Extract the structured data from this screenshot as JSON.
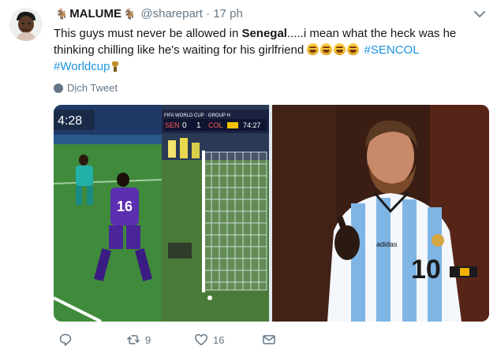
{
  "tweet": {
    "author_name": "MALUME",
    "handle": "@sharepart",
    "separator": "·",
    "time": "17 ph",
    "text_parts": {
      "t1": "This guys must never be allowed in ",
      "t2": "Senegal",
      "t3": ".....i mean what the heck was he thinking chilling like he's waiting for his girlfriend ",
      "t4": "#SENCOL",
      "t5": "#Worldcup"
    },
    "translate_label": "Dịch Tweet",
    "emoji_name": "tears-of-joy-emoji",
    "trophy_name": "trophy-emoji"
  },
  "media": {
    "left_photo": {
      "clock": "4:28",
      "broadcast_banner": "FIFA WORLD CUP · GROUP H",
      "score_left_team": "SEN",
      "score_left": "0",
      "score_right": "1",
      "score_right_team": "COL",
      "match_clock": "74:27",
      "player_number": "16"
    },
    "right_photo": {
      "shirt_number": "10",
      "brand": "adidas"
    }
  },
  "actions": {
    "reply_count": "",
    "retweet_count": "9",
    "like_count": "16"
  },
  "colors": {
    "link": "#1b95e0",
    "secondary_text": "#657786",
    "primary_text": "#14171a"
  }
}
